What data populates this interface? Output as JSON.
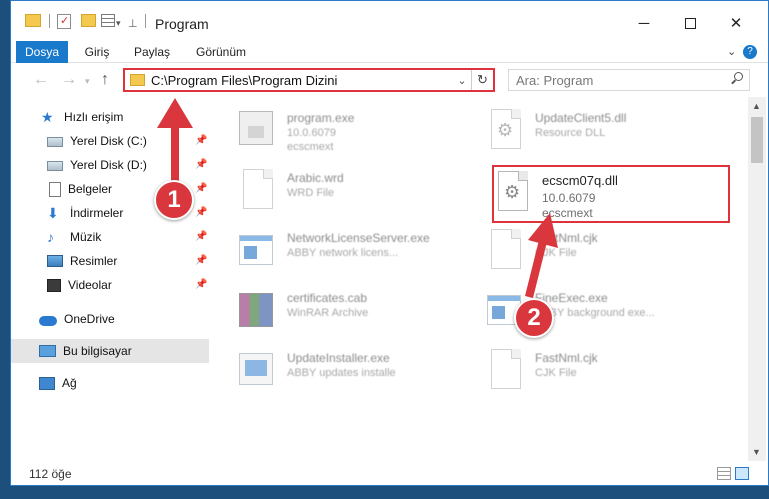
{
  "title_bar": {
    "title": "Program",
    "minimize_label": "─",
    "close_label": "✕"
  },
  "ribbon": {
    "tabs": [
      "Dosya",
      "Giriş",
      "Paylaş",
      "Görünüm"
    ],
    "help_label": "?"
  },
  "nav": {
    "address": "C:\\Program Files\\Program Dizini",
    "search_placeholder": "Ara: Program"
  },
  "sidebar": {
    "items": [
      {
        "label": "Hızlı erişim",
        "icon": "star-icon"
      },
      {
        "label": "Yerel Disk (C:)",
        "icon": "drive-icon"
      },
      {
        "label": "Yerel Disk (D:)",
        "icon": "drive-icon"
      },
      {
        "label": "Belgeler",
        "icon": "documents-icon"
      },
      {
        "label": "İndirmeler",
        "icon": "downloads-icon"
      },
      {
        "label": "Müzik",
        "icon": "music-icon"
      },
      {
        "label": "Resimler",
        "icon": "pictures-icon"
      },
      {
        "label": "Videolar",
        "icon": "videos-icon"
      },
      {
        "label": "OneDrive",
        "icon": "cloud-icon"
      },
      {
        "label": "Bu bilgisayar",
        "icon": "computer-icon"
      },
      {
        "label": "Ağ",
        "icon": "network-icon"
      }
    ]
  },
  "files": [
    {
      "name": "program.exe",
      "line1": "10.0.6079",
      "line2": "ecscmext"
    },
    {
      "name": "UpdateClient5.dll",
      "line1": "Resource DLL",
      "line2": ""
    },
    {
      "name": "Arabic.wrd",
      "line1": "WRD File",
      "line2": ""
    },
    {
      "name": "ecscm07q.dll",
      "line1": "10.0.6079",
      "line2": "ecscmext"
    },
    {
      "name": "NetworkLicenseServer.exe",
      "line1": "ABBY network licens...",
      "line2": ""
    },
    {
      "name": "FastNml.cjk",
      "line1": "CJK File",
      "line2": ""
    },
    {
      "name": "certificates.cab",
      "line1": "WinRAR Archive",
      "line2": ""
    },
    {
      "name": "FineExec.exe",
      "line1": "ABBY background exe...",
      "line2": ""
    },
    {
      "name": "UpdateInstaller.exe",
      "line1": "ABBY updates installe",
      "line2": ""
    },
    {
      "name": "FastNml.cjk",
      "line1": "CJK File",
      "line2": ""
    }
  ],
  "status": {
    "item_count": "112 öğe"
  },
  "annotations": {
    "step1": "1",
    "step2": "2"
  },
  "colors": {
    "accent": "#1979ca",
    "highlight_border": "#e0323a",
    "arrow": "#d9363e"
  }
}
